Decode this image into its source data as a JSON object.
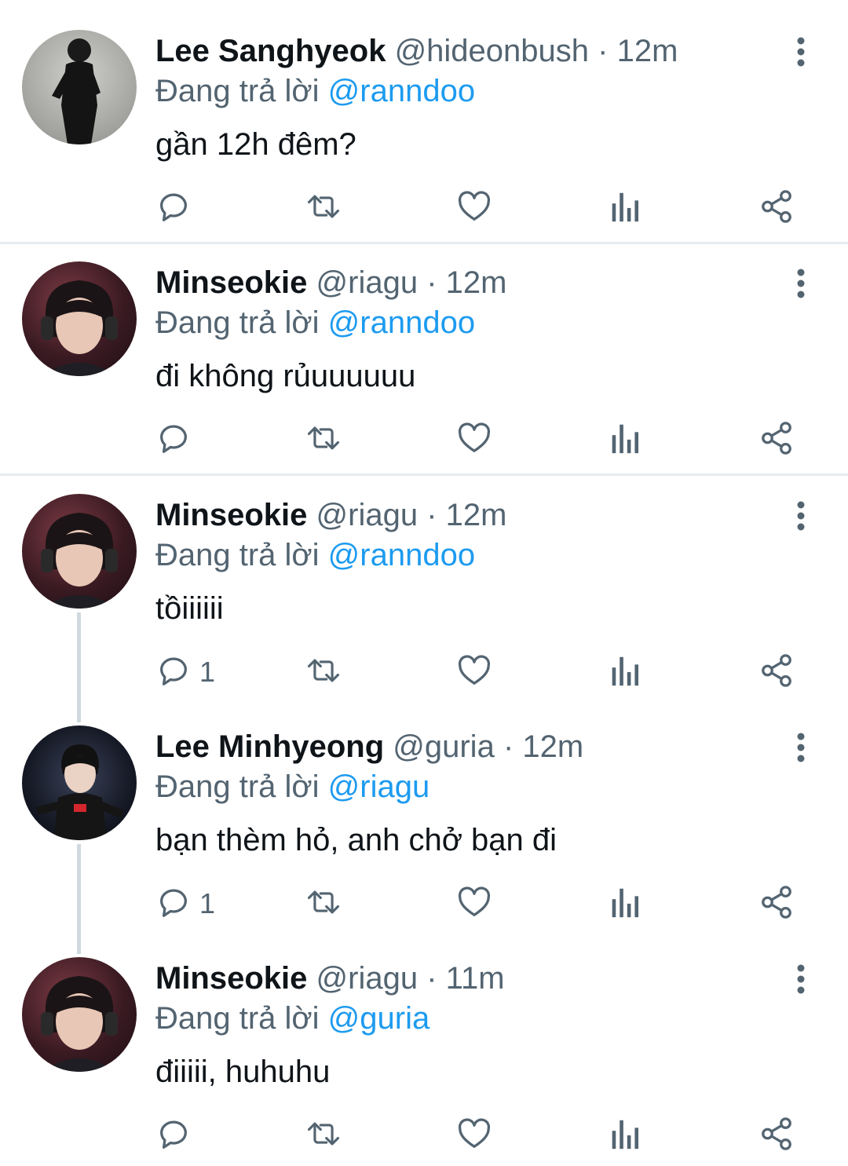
{
  "feed": {
    "tweets": [
      {
        "name": "Lee Sanghyeok",
        "handle": "@hideonbush",
        "dot": "·",
        "time": "12m",
        "replying_prefix": "Đang trả lời",
        "replying_to": "@ranndoo",
        "text": "gần 12h đêm?",
        "reply_count": "",
        "avatar": "gray"
      },
      {
        "name": "Minseokie",
        "handle": "@riagu",
        "dot": "·",
        "time": "12m",
        "replying_prefix": "Đang trả lời",
        "replying_to": "@ranndoo",
        "text": "đi không rủuuuuuu",
        "reply_count": "",
        "avatar": "red"
      },
      {
        "name": "Minseokie",
        "handle": "@riagu",
        "dot": "·",
        "time": "12m",
        "replying_prefix": "Đang trả lời",
        "replying_to": "@ranndoo",
        "text": "tồiiiiii",
        "reply_count": "1",
        "avatar": "red"
      },
      {
        "name": "Lee Minhyeong",
        "handle": "@guria",
        "dot": "·",
        "time": "12m",
        "replying_prefix": "Đang trả lời",
        "replying_to": "@riagu",
        "text": "bạn thèm hỏ, anh chở bạn đi",
        "reply_count": "1",
        "avatar": "dark"
      },
      {
        "name": "Minseokie",
        "handle": "@riagu",
        "dot": "·",
        "time": "11m",
        "replying_prefix": "Đang trả lời",
        "replying_to": "@guria",
        "text": "điiiii, huhuhu",
        "reply_count": "",
        "avatar": "red"
      }
    ]
  },
  "icons": {
    "reply": "reply-icon",
    "retweet": "retweet-icon",
    "like": "heart-icon",
    "views": "views-icon",
    "share": "share-icon",
    "more": "more-vertical-icon"
  },
  "colors": {
    "text": "#0f1419",
    "secondary": "#536471",
    "mention": "#1d9bf0",
    "thread_line": "#cfd9de",
    "separator": "#e6ecf0"
  }
}
